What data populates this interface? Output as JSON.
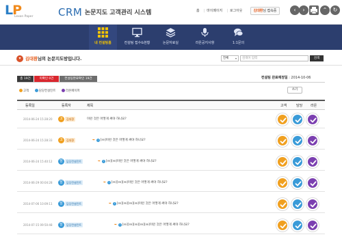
{
  "header": {
    "logo_mark": "LP",
    "logo_sub": "Lexon Paper",
    "crm": "CRM",
    "title": "논문지도 고객관리 시스템",
    "links": [
      "홈",
      "마이페이지",
      "로그아웃"
    ],
    "user_name": "김대환",
    "user_suffix": "님 접속중"
  },
  "nav": {
    "items": [
      {
        "label": "내 컨설팅홈",
        "icon": "grid-icon",
        "active": true
      },
      {
        "label": "컨설팅 접수&현황",
        "icon": "monitor-icon",
        "active": false
      },
      {
        "label": "논문자료실",
        "icon": "layers-icon",
        "active": false
      },
      {
        "label": "라온공지사항",
        "icon": "microphone-icon",
        "active": false
      },
      {
        "label": "1:1문의",
        "icon": "chat-icon",
        "active": false
      }
    ]
  },
  "greeting": {
    "name": "김대환",
    "text": "님의 논문지도방입니다."
  },
  "search": {
    "select_value": "전체",
    "placeholder": "검색어 입력",
    "button": "검색"
  },
  "tabs": [
    {
      "label": "총 19건",
      "color": "#3a3a3a"
    },
    {
      "label": "미확인 0건",
      "color": "#d9272e"
    },
    {
      "label": "컨설팅완료확인 19건",
      "color": "#6d6d6d"
    }
  ],
  "consult_date": {
    "label": "컨설팅 완료예정일",
    "value": " : 2014-10-06"
  },
  "legend": [
    {
      "label": "고객",
      "color": "#f0a020"
    },
    {
      "label": "담당컨설턴트",
      "color": "#3a9bd8"
    },
    {
      "label": "라온페이퍼",
      "color": "#7b3fb0"
    }
  ],
  "view_button": "쓰기",
  "table": {
    "headers": {
      "date": "등록일",
      "author": "등록자",
      "subject": "제목",
      "customer": "고객",
      "manager": "담당",
      "raon": "라온"
    },
    "rows": [
      {
        "date": "2014-06-24 15:28:20",
        "badge_char": "고",
        "badge_color": "#f0a020",
        "badge_label": "김대환",
        "badge_bg": "#fde9cc",
        "badge_fg": "#c06000",
        "subject": "이런 것은 어떻게 써야 하나요?",
        "depth": 0
      },
      {
        "date": "2014-06-24 15:28:33",
        "badge_char": "고",
        "badge_color": "#f0a020",
        "badge_label": "김대환",
        "badge_bg": "#fde9cc",
        "badge_fg": "#c06000",
        "subject": "[re]이런 것은 어떻게 써야 하나요?",
        "depth": 1
      },
      {
        "date": "2014-06-24 15:40:12",
        "badge_char": "담",
        "badge_color": "#3a9bd8",
        "badge_label": "담당컨설턴트",
        "badge_bg": "#dcecf8",
        "badge_fg": "#1e6aa5",
        "subject": "[re][re]이런 것은 어떻게 써야 하나요?",
        "depth": 2
      },
      {
        "date": "2014-06-29 00:04:28",
        "badge_char": "담",
        "badge_color": "#3a9bd8",
        "badge_label": "담당컨설턴트",
        "badge_bg": "#dcecf8",
        "badge_fg": "#1e6aa5",
        "subject": "[re][re][re]이런 것은 어떻게 써야 하나요?",
        "depth": 3
      },
      {
        "date": "2014-07-06 10:09:11",
        "badge_char": "담",
        "badge_color": "#3a9bd8",
        "badge_label": "담당컨설턴트",
        "badge_bg": "#dcecf8",
        "badge_fg": "#1e6aa5",
        "subject": "[re][re][re][re]이런 것은 어떻게 써야 하나요?",
        "depth": 4
      },
      {
        "date": "2014-07-15 09:50:48",
        "badge_char": "담",
        "badge_color": "#3a9bd8",
        "badge_label": "담당컨설턴트",
        "badge_bg": "#dcecf8",
        "badge_fg": "#1e6aa5",
        "subject": "[re][re][re][re][re]이런 것은 어떻게 써야 하나요?",
        "depth": 5
      }
    ],
    "check_colors": {
      "customer": "#f0a020",
      "manager": "#3a9bd8",
      "raon": "#7b3fb0"
    }
  }
}
